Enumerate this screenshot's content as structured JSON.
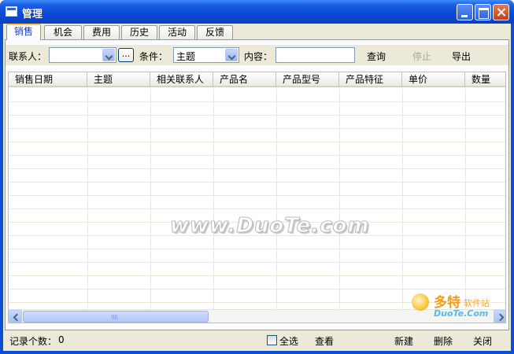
{
  "window": {
    "title": "管理"
  },
  "tabs": [
    {
      "label": "销售",
      "active": true
    },
    {
      "label": "机会"
    },
    {
      "label": "费用"
    },
    {
      "label": "历史"
    },
    {
      "label": "活动"
    },
    {
      "label": "反馈"
    }
  ],
  "filter": {
    "contact_label": "联系人：",
    "contact_value": "",
    "browse_label": "...",
    "condition_label": "条件：",
    "condition_value": "主题",
    "content_label": "内容：",
    "content_value": "",
    "query_label": "查询",
    "stop_label": "停止",
    "export_label": "导出"
  },
  "grid": {
    "columns": [
      "销售日期",
      "主题",
      "相关联系人",
      "产品名",
      "产品型号",
      "产品特征",
      "单价",
      "数量"
    ],
    "rows": []
  },
  "watermark": "www.DuoTe.com",
  "footer": {
    "record_count_label": "记录个数：",
    "record_count": "0",
    "select_all_label": "全选",
    "view_label": "查看",
    "new_label": "新建",
    "delete_label": "删除",
    "close_label": "关闭"
  },
  "site_logo": {
    "main": "多特",
    "sub": "软件站",
    "url": "DuoTe.Com"
  },
  "colors": {
    "titlebar": "#0a4bd8",
    "face": "#ece9d8",
    "tab_highlight": "#ffc73c"
  }
}
